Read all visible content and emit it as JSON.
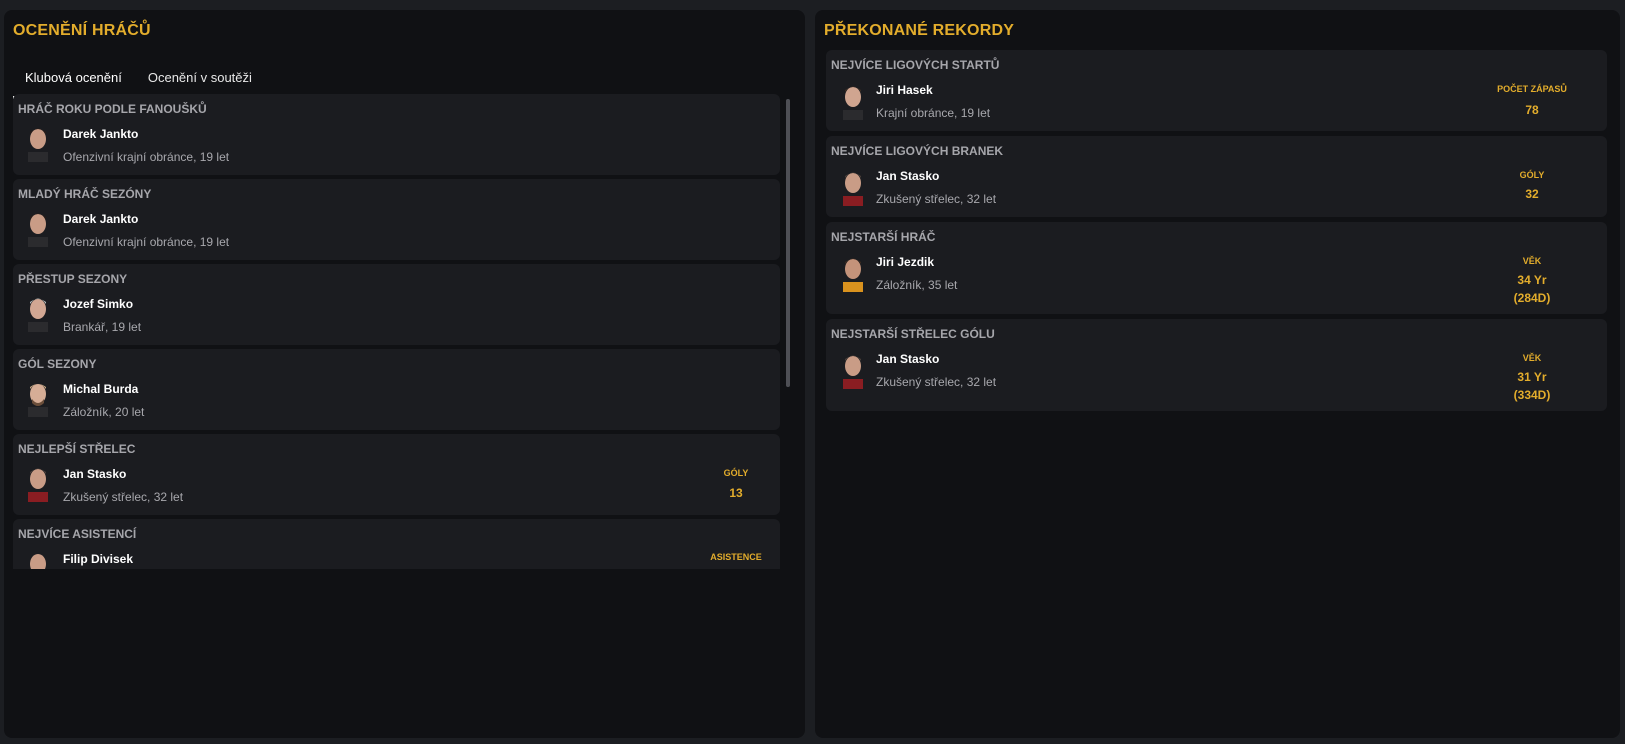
{
  "left": {
    "title": "OCENĚNÍ HRÁČŮ",
    "tabs": [
      {
        "label": "Klubová ocenění",
        "active": true
      },
      {
        "label": "Ocenění v soutěži",
        "active": false
      }
    ],
    "awards": [
      {
        "label": "HRÁČ ROKU PODLE FANOUŠKŮ",
        "name": "Darek Jankto",
        "desc": "Ofenzivní krajní obránce, 19 let"
      },
      {
        "label": "MLADÝ HRÁČ SEZÓNY",
        "name": "Darek Jankto",
        "desc": "Ofenzivní krajní obránce, 19 let"
      },
      {
        "label": "PŘESTUP SEZONY",
        "name": "Jozef Simko",
        "desc": "Brankář, 19 let"
      },
      {
        "label": "GÓL SEZONY",
        "name": "Michal Burda",
        "desc": "Záložník, 20 let"
      },
      {
        "label": "NEJLEPŠÍ STŘELEC",
        "name": "Jan Stasko",
        "desc": "Zkušený střelec, 32 let",
        "stat_label": "GÓLY",
        "stat_value": "13"
      },
      {
        "label": "NEJVÍCE ASISTENCÍ",
        "name": "Filip Divisek",
        "desc": "",
        "stat_label": "ASISTENCE",
        "stat_value": ""
      }
    ]
  },
  "right": {
    "title": "PŘEKONANÉ REKORDY",
    "records": [
      {
        "label": "NEJVÍCE LIGOVÝCH STARTŮ",
        "name": "Jiri Hasek",
        "desc": "Krajní obránce, 19 let",
        "stat_label": "POČET ZÁPASŮ",
        "stat_value": "78"
      },
      {
        "label": "NEJVÍCE LIGOVÝCH BRANEK",
        "name": "Jan Stasko",
        "desc": "Zkušený střelec, 32 let",
        "stat_label": "GÓLY",
        "stat_value": "32"
      },
      {
        "label": "NEJSTARŠÍ HRÁČ",
        "name": "Jiri Jezdik",
        "desc": "Záložník, 35 let",
        "stat_label": "VĚK",
        "stat_value": "34 Yr",
        "stat_value2": "(284D)"
      },
      {
        "label": "NEJSTARŠÍ STŘELEC GÓLU",
        "name": "Jan Stasko",
        "desc": "Zkušený střelec, 32 let",
        "stat_label": "VĚK",
        "stat_value": "31 Yr",
        "stat_value2": "(334D)"
      }
    ]
  },
  "colors": {
    "accent": "#e3ad2c",
    "panel": "#101114",
    "card": "#1b1c20"
  },
  "icons": [
    "player-avatar-icon"
  ]
}
